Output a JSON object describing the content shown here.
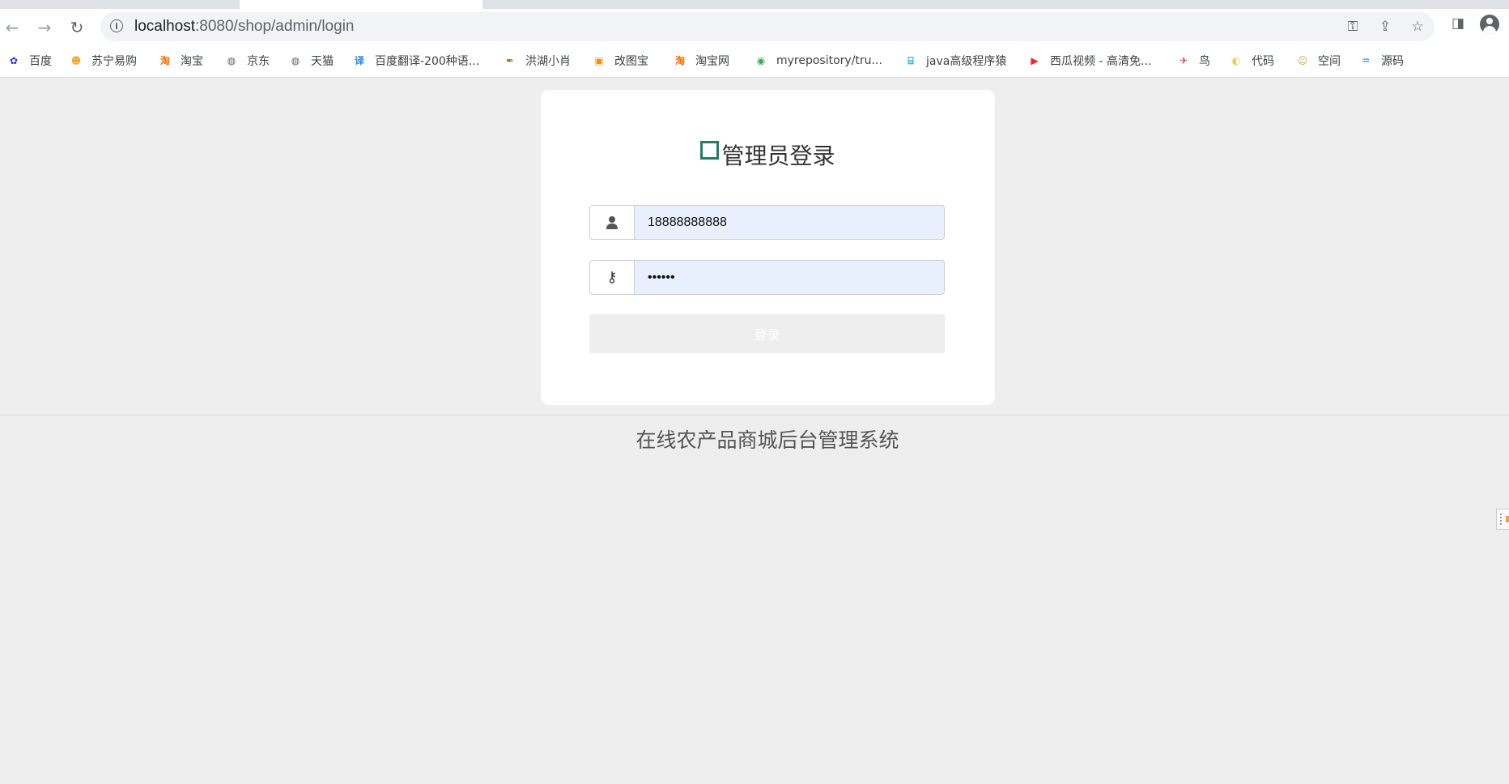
{
  "browser": {
    "url_host": "localhost",
    "url_rest": ":8080/shop/admin/login",
    "bookmarks": [
      {
        "label": "百度",
        "icon": "paw-icon",
        "color": "#2932e1",
        "glyph": "✿"
      },
      {
        "label": "苏宁易购",
        "icon": "lion-icon",
        "color": "#f5a623",
        "glyph": "☻"
      },
      {
        "label": "淘宝",
        "icon": "taobao-icon",
        "color": "#ff6a00",
        "glyph": "淘"
      },
      {
        "label": "京东",
        "icon": "globe-icon",
        "color": "#5f6368",
        "glyph": "◍"
      },
      {
        "label": "天猫",
        "icon": "globe-icon",
        "color": "#5f6368",
        "glyph": "◍"
      },
      {
        "label": "百度翻译-200种语...",
        "icon": "translate-icon",
        "color": "#2c7cf6",
        "glyph": "译"
      },
      {
        "label": "洪湖小肖",
        "icon": "feather-icon",
        "color": "#8a6d3b",
        "glyph": "✒"
      },
      {
        "label": "改图宝",
        "icon": "image-tool-icon",
        "color": "#ff8800",
        "glyph": "▣"
      },
      {
        "label": "淘宝网",
        "icon": "taobao-icon",
        "color": "#ff6a00",
        "glyph": "淘"
      },
      {
        "label": "myrepository/tru...",
        "icon": "chrome-icon",
        "color": "#34a853",
        "glyph": "◉"
      },
      {
        "label": "java高级程序猿",
        "icon": "bilibili-icon",
        "color": "#00a1d6",
        "glyph": "⌸"
      },
      {
        "label": "西瓜视频 - 高清免...",
        "icon": "play-icon",
        "color": "#f5222d",
        "glyph": "▶"
      },
      {
        "label": "鸟",
        "icon": "bird-icon",
        "color": "#e53935",
        "glyph": "✈"
      },
      {
        "label": "代码",
        "icon": "code-icon",
        "color": "#f2c94c",
        "glyph": "◐"
      },
      {
        "label": "空间",
        "icon": "space-icon",
        "color": "#d4a64f",
        "glyph": "☺"
      },
      {
        "label": "源码",
        "icon": "fish-icon",
        "color": "#2f80ed",
        "glyph": "♒"
      }
    ]
  },
  "login": {
    "title": "管理员登录",
    "username_value": "18888888888",
    "password_value": "••••••",
    "button_label": "登录"
  },
  "footer": {
    "text": "在线农产品商城后台管理系统"
  }
}
